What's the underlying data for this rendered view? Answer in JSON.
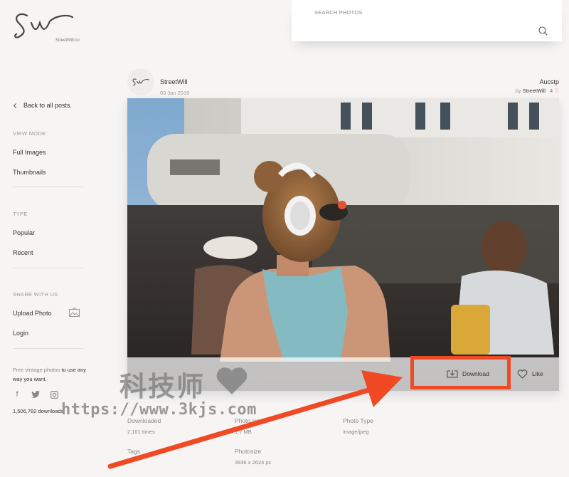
{
  "brand": {
    "logo_text": "Sw",
    "site_name": "StreetWill.co"
  },
  "search": {
    "label": "SEARCH PHOTOS"
  },
  "sidebar": {
    "back_label": "Back to all posts.",
    "view_mode": {
      "heading": "VIEW MODE",
      "items": [
        "Full Images",
        "Thumbnails"
      ]
    },
    "type": {
      "heading": "TYPE",
      "items": [
        "Popular",
        "Recent"
      ]
    },
    "share": {
      "heading": "SHARE WITH US",
      "upload_label": "Upload Photo",
      "login_label": "Login"
    },
    "blurb_lead": "Free vintage photos",
    "blurb_rest": " to use any way you want.",
    "social_icons": [
      "facebook-icon",
      "twitter-icon",
      "instagram-icon"
    ],
    "downloads_count": "1,506,782 downloads"
  },
  "post": {
    "author": "StreetWill",
    "date": "03 Jan 2015",
    "album": "Aucstp",
    "by_prefix": "by",
    "by_name": "StreetWill",
    "likes": "4"
  },
  "actions": {
    "download_label": "Download",
    "like_label": "Like"
  },
  "meta": {
    "downloaded_label": "Downloaded",
    "downloaded_value": "2,101 times",
    "filesize_label": "Photo size",
    "filesize_value": "1.7 MB",
    "type_label": "Photo Type",
    "type_value": "image/jpeg",
    "tags_label": "Tags",
    "dims_label": "Photosize",
    "dims_value": "3936 x 2624 px"
  },
  "watermark": {
    "cn": "科技师",
    "url": "https://www.3kjs.com"
  },
  "colors": {
    "accent_red": "#f04a25",
    "like_heart": "#d9534f"
  }
}
